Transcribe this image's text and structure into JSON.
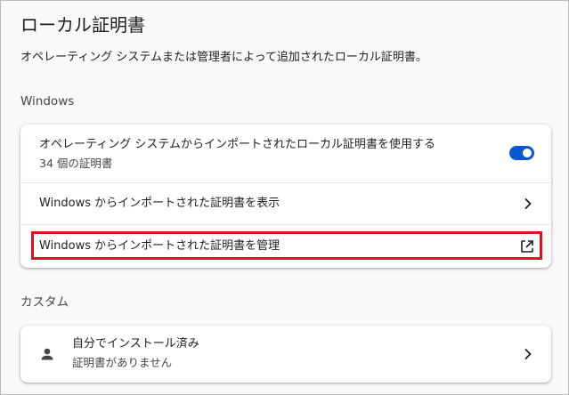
{
  "page": {
    "title": "ローカル証明書",
    "description": "オペレーティング システムまたは管理者によって追加されたローカル証明書。"
  },
  "windows_section": {
    "heading": "Windows",
    "use_imported": {
      "label": "オペレーティング システムからインポートされたローカル証明書を使用する",
      "sublabel": "34 個の証明書",
      "enabled": true
    },
    "view_imported": {
      "label": "Windows からインポートされた証明書を表示"
    },
    "manage_imported": {
      "label": "Windows からインポートされた証明書を管理"
    }
  },
  "custom_section": {
    "heading": "カスタム",
    "user_installed": {
      "label": "自分でインストール済み",
      "sublabel": "証明書がありません"
    }
  },
  "colors": {
    "accent": "#0b57d0",
    "highlight": "#e0101e",
    "background": "#f8f9fa"
  },
  "icons": {
    "toggle": "toggle-on",
    "view": "chevron-right-icon",
    "manage": "open-in-new-icon",
    "person": "person-icon",
    "custom_chevron": "chevron-right-icon"
  }
}
